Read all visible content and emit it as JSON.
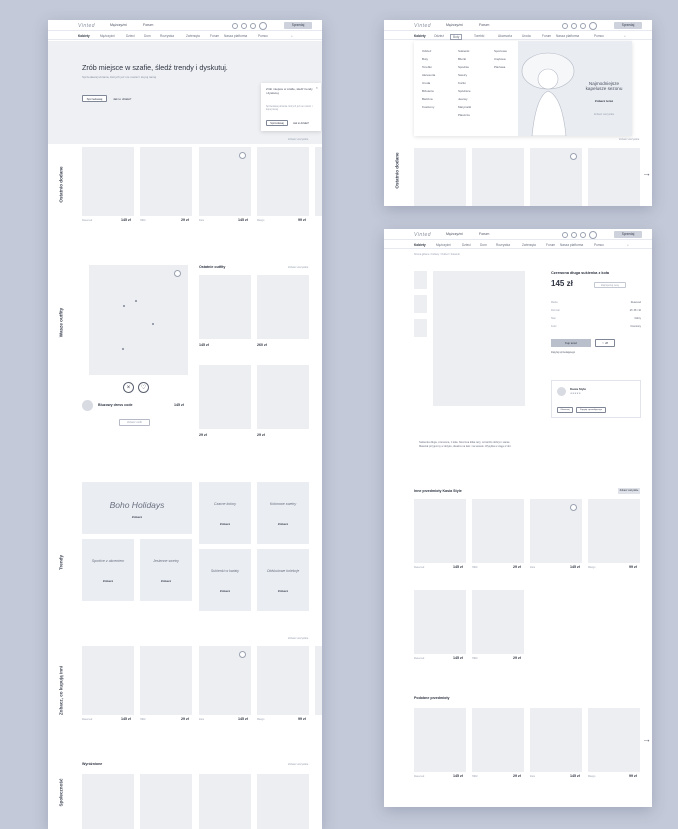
{
  "brand": {
    "logo": "Vinted"
  },
  "nav": {
    "tab_men": "Mężczyźni",
    "tab_forum": "Forum",
    "signin": "Sprzedaj"
  },
  "categories": [
    "Kobiety",
    "Mężczyźni",
    "Dzieci",
    "Dom",
    "Rozrywka",
    "Zwierzęta",
    "Forum",
    "Nasza platforma",
    "Pomoc"
  ],
  "categories_ext": [
    "Kobiety",
    "Odzież",
    "Buty",
    "Torebki",
    "Akcesoria",
    "Uroda",
    "Forum",
    "Nasza platforma",
    "Pomoc"
  ],
  "hero": {
    "title": "Zrób miejsce w szafie, śledź trendy i dyskutuj.",
    "subtitle": "Sprzedawaj ubrania, których już nie nosisz i kupuj taniej",
    "cta_primary": "Sprzedawaj",
    "cta_secondary": "Jak to działa?",
    "popup_title": "Zrób miejsce w szafie, śledź trendy i dyskutuj.",
    "popup_body": "Sprzedawaj ubrania, których już nie nosisz i kupuj taniej",
    "popup_btn": "Sprzedawaj",
    "popup_link": "Jak to działa?"
  },
  "sections": {
    "recent": "Ostatnio dodane",
    "outfits": "Wasze outfity",
    "trends": "Trendy",
    "watch": "Zobacz, co kupują inni",
    "community": "Społeczność",
    "see_all": "Zobacz wszystkie",
    "latest_outfits": "Ostatnie outfity",
    "popular": "Wyróżnione"
  },
  "products": [
    {
      "price": "145 zł",
      "size": "M",
      "brand": "Reserved"
    },
    {
      "price": "29 zł",
      "size": "S",
      "brand": "H&M"
    },
    {
      "price": "145 zł",
      "size": "M",
      "brand": "Zara"
    },
    {
      "price": "99 zł",
      "size": "L",
      "brand": "Mango"
    }
  ],
  "outfit": {
    "name": "Bluzowy dress code",
    "price": "145 zł",
    "link": "Zobacz outfit"
  },
  "small_outfits": [
    {
      "price": "145 zł"
    },
    {
      "price": "260 zł"
    },
    {
      "price": "29 zł"
    },
    {
      "price": "29 zł"
    }
  ],
  "trends": {
    "big": "Boho Holidays",
    "items": [
      "Czarne kolory",
      "Kolorowe swetry",
      "Sportive z akcentem",
      "Jesienne swetry",
      "Sukienki w kwiaty",
      "Oldskulowe kolekcje"
    ],
    "see": "Zobacz"
  },
  "menu": {
    "col1": [
      "Odzież",
      "Buty",
      "Torebki",
      "Akcesoria",
      "Uroda",
      "Biżuteria",
      "Bielizna",
      "Kostiumy"
    ],
    "col2": [
      "Sukienki",
      "Bluzki",
      "Spodnie",
      "Swetry",
      "Kurtki",
      "Spódnice",
      "Jeansy",
      "Marynarki",
      "Płaszcze"
    ],
    "col3": [
      "Sportowa",
      "Ciążowa",
      "Plażowa"
    ],
    "promo_title": "Najmodniejsze kapelusze sezonu",
    "promo_shop": "Zobacz teraz",
    "promo_link": "Zobacz wszystkie"
  },
  "product": {
    "breadcrumb": "Strona główna / Kobiety / Odzież / Sukienki",
    "title": "Czerwona długa sukienka z koła",
    "price": "145 zł",
    "rows": [
      {
        "label": "Marka",
        "value": "Reserved"
      },
      {
        "label": "Rozmiar",
        "value": "M / 38 / 10"
      },
      {
        "label": "Stan",
        "value": "Dobry"
      },
      {
        "label": "Kolor",
        "value": "Czerwony"
      }
    ],
    "buy": "Kup teraz",
    "offer": "Zaproponuj cenę",
    "ask": "Zapytaj sprzedającego",
    "seller": "Kasia Style",
    "description": "Sukienka długa, czerwona, z koła. Noszona kilka razy, w bardzo dobrym stanie. Materiał przyjemny w dotyku, idealna na lato i na wesele. Wysyłka w ciągu 2 dni.",
    "more_from": "Inne przedmioty Kasia Style",
    "similar": "Podobne przedmioty",
    "follow": "Obserwuj"
  }
}
